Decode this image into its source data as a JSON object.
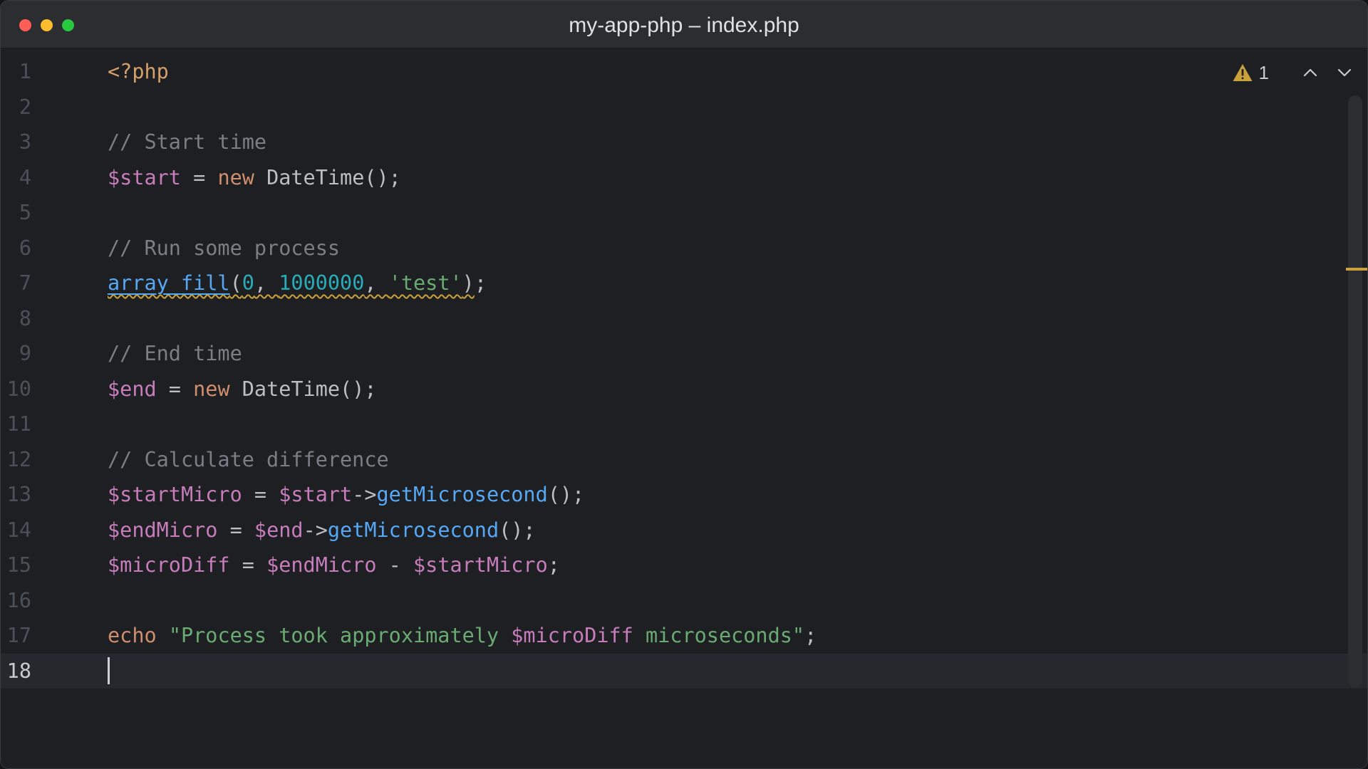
{
  "window": {
    "title": "my-app-php – index.php"
  },
  "inspections": {
    "warning_count": "1",
    "warning_icon": "warning-triangle-icon",
    "prev_icon": "chevron-up-icon",
    "next_icon": "chevron-down-icon"
  },
  "colors": {
    "keyword": "#cf8e6d",
    "comment": "#7a7e85",
    "variable": "#c77dbb",
    "function": "#56a8f5",
    "number": "#2aacb8",
    "string": "#6aab73",
    "warning": "#c9a23a"
  },
  "editor": {
    "current_line": "18",
    "lines": [
      {
        "n": "1",
        "tokens": [
          {
            "t": "tag",
            "v": "<?php"
          }
        ]
      },
      {
        "n": "2",
        "tokens": []
      },
      {
        "n": "3",
        "tokens": [
          {
            "t": "cm",
            "v": "// Start time"
          }
        ]
      },
      {
        "n": "4",
        "tokens": [
          {
            "t": "var",
            "v": "$start"
          },
          {
            "t": "pl",
            "v": " = "
          },
          {
            "t": "kw",
            "v": "new"
          },
          {
            "t": "pl",
            "v": " DateTime();"
          }
        ]
      },
      {
        "n": "5",
        "tokens": []
      },
      {
        "n": "6",
        "tokens": [
          {
            "t": "cm",
            "v": "// Run some process"
          }
        ]
      },
      {
        "n": "7",
        "warn": true,
        "tokens": [
          {
            "t": "fn-ul",
            "v": "array_fill"
          },
          {
            "t": "pl",
            "v": "("
          },
          {
            "t": "num",
            "v": "0"
          },
          {
            "t": "pl",
            "v": ", "
          },
          {
            "t": "num",
            "v": "1000000"
          },
          {
            "t": "pl",
            "v": ", "
          },
          {
            "t": "str",
            "v": "'test'"
          },
          {
            "t": "pl",
            "v": ")"
          }
        ],
        "tail": [
          {
            "t": "pl",
            "v": ";"
          }
        ]
      },
      {
        "n": "8",
        "tokens": []
      },
      {
        "n": "9",
        "tokens": [
          {
            "t": "cm",
            "v": "// End time"
          }
        ]
      },
      {
        "n": "10",
        "tokens": [
          {
            "t": "var",
            "v": "$end"
          },
          {
            "t": "pl",
            "v": " = "
          },
          {
            "t": "kw",
            "v": "new"
          },
          {
            "t": "pl",
            "v": " DateTime();"
          }
        ]
      },
      {
        "n": "11",
        "tokens": []
      },
      {
        "n": "12",
        "tokens": [
          {
            "t": "cm",
            "v": "// Calculate difference"
          }
        ]
      },
      {
        "n": "13",
        "tokens": [
          {
            "t": "var",
            "v": "$startMicro"
          },
          {
            "t": "pl",
            "v": " = "
          },
          {
            "t": "var",
            "v": "$start"
          },
          {
            "t": "pl",
            "v": "->"
          },
          {
            "t": "fn",
            "v": "getMicrosecond"
          },
          {
            "t": "pl",
            "v": "();"
          }
        ]
      },
      {
        "n": "14",
        "tokens": [
          {
            "t": "var",
            "v": "$endMicro"
          },
          {
            "t": "pl",
            "v": " = "
          },
          {
            "t": "var",
            "v": "$end"
          },
          {
            "t": "pl",
            "v": "->"
          },
          {
            "t": "fn",
            "v": "getMicrosecond"
          },
          {
            "t": "pl",
            "v": "();"
          }
        ]
      },
      {
        "n": "15",
        "tokens": [
          {
            "t": "var",
            "v": "$microDiff"
          },
          {
            "t": "pl",
            "v": " = "
          },
          {
            "t": "var",
            "v": "$endMicro"
          },
          {
            "t": "pl",
            "v": " - "
          },
          {
            "t": "var",
            "v": "$startMicro"
          },
          {
            "t": "pl",
            "v": ";"
          }
        ]
      },
      {
        "n": "16",
        "tokens": []
      },
      {
        "n": "17",
        "tokens": [
          {
            "t": "kw",
            "v": "echo"
          },
          {
            "t": "pl",
            "v": " "
          },
          {
            "t": "str",
            "v": "\"Process took approximately "
          },
          {
            "t": "var",
            "v": "$microDiff"
          },
          {
            "t": "str",
            "v": " microseconds\""
          },
          {
            "t": "pl",
            "v": ";"
          }
        ]
      },
      {
        "n": "18",
        "tokens": [],
        "caret": true
      }
    ]
  }
}
